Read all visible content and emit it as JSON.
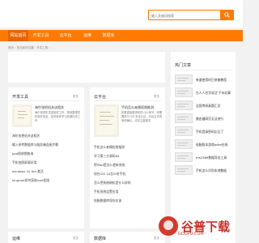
{
  "search": {
    "placeholder": "输入关键词搜索"
  },
  "nav": {
    "items": [
      {
        "label": "网站首页",
        "active": true
      },
      {
        "label": "开发工具",
        "active": false
      },
      {
        "label": "云平台",
        "active": false
      },
      {
        "label": "运维",
        "active": false
      },
      {
        "label": "数据库",
        "active": false
      }
    ]
  },
  "breadcrumb": "首页 › 您当前的位置：开发工具 ›",
  "panels": {
    "dev_tools": {
      "title": "开发工具",
      "more": "更多",
      "featured_title": "海尔张把机关送相关",
      "featured_desc": "海尔张把机关送相关工作，现就整理发布相关信息，给您参考学习资源在线工作",
      "list": [
        "海尔张把机关送相关",
        "输入参考数据库与服务端连接步骤",
        "pad保修期查询",
        "手机拍照屏幕好用",
        "windows 10 fire 激活",
        "kingroot如何获取root权限"
      ]
    },
    "cloud": {
      "title": "云平台",
      "more": "更多",
      "featured_title": "手机怎么来摸权限推测",
      "featured_desc": "如果直接登录你的 QQ 帐号，则需要进行 QQ 安全认证，可自主完成修改确认，请关注各服务",
      "list": [
        "手机怎么来摸权限推测",
        "学习第三方源码64",
        "把iPad是怎么更新系统",
        "现在iOS 10怎么给手机",
        "怎么把系统刷机是什么样的",
        "手机系统设置应用",
        "电脑数据库保存应该"
      ]
    },
    "ops": {
      "title": "运维",
      "more": "更多"
    },
    "database": {
      "title": "数据库",
      "more": "更多"
    }
  },
  "sidebar": {
    "title": "热门文章",
    "items": [
      "有道使用时已修复教程",
      "古人人名字说活 千年纪事",
      "全国考研真题汇总",
      "路由器网页无法进行",
      "手机登录密码忘记了",
      "电脑版本游戏wihe在线",
      "ms2369数据导出工具",
      "手机怎么识别本地数据"
    ]
  },
  "watermark": {
    "text": "谷普下载",
    "sub": "GOOPU.COM"
  },
  "colors": {
    "accent": "#ff7a00",
    "accent_dark": "#e86400"
  }
}
